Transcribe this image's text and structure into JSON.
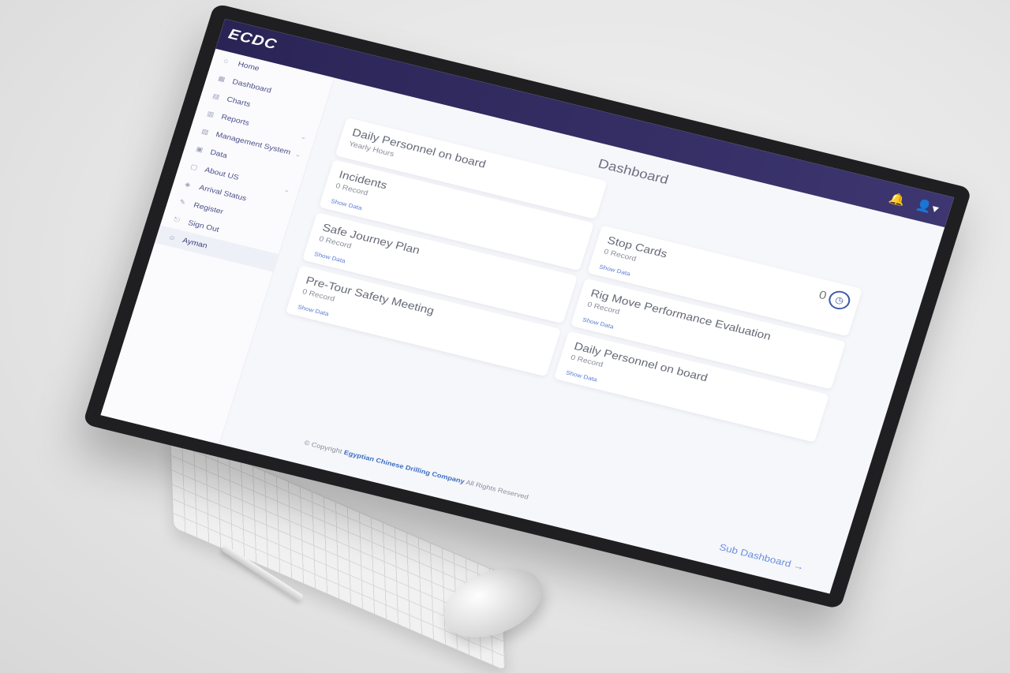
{
  "brand": {
    "logo_text": "ECDC"
  },
  "topbar": {
    "bell_icon": "bell-icon",
    "user_icon": "user-icon"
  },
  "sidebar": {
    "items": [
      {
        "label": "Home",
        "icon": "home-icon"
      },
      {
        "label": "Dashboard",
        "icon": "dashboard-icon"
      },
      {
        "label": "Charts",
        "icon": "chart-icon"
      },
      {
        "label": "Reports",
        "icon": "report-icon",
        "has_chevron": true
      },
      {
        "label": "Management System",
        "icon": "folder-icon",
        "has_chevron": true
      },
      {
        "label": "Data",
        "icon": "data-icon"
      },
      {
        "label": "About US",
        "icon": "info-icon",
        "has_chevron": true
      },
      {
        "label": "Arrival Status",
        "icon": "status-icon"
      },
      {
        "label": "Register",
        "icon": "register-icon"
      },
      {
        "label": "Sign Out",
        "icon": "signout-icon"
      },
      {
        "label": "Ayman",
        "icon": "user-icon"
      }
    ]
  },
  "main": {
    "title": "Dashboard",
    "cards": [
      {
        "title": "Daily Personnel on board",
        "subtitle": "Yearly Hours"
      },
      {
        "title": "Incidents",
        "subtitle": "0 Record",
        "link": "Show Data"
      },
      {
        "title": "Stop Cards",
        "subtitle": "0 Record",
        "link": "Show Data",
        "value": "0"
      },
      {
        "title": "Safe Journey Plan",
        "subtitle": "0 Record",
        "link": "Show Data"
      },
      {
        "title": "Rig Move Performance Evaluation",
        "subtitle": "0 Record",
        "link": "Show Data"
      },
      {
        "title": "Pre-Tour Safety Meeting",
        "subtitle": "0 Record",
        "link": "Show Data"
      },
      {
        "title": "Daily Personnel on board",
        "subtitle": "0 Record",
        "link": "Show Data"
      }
    ],
    "sub_dashboard_label": "Sub Dashboard →"
  },
  "footer": {
    "prefix": "© Copyright",
    "company": "Egyptian Chinese Drilling Company",
    "suffix": "All Rights Reserved"
  }
}
